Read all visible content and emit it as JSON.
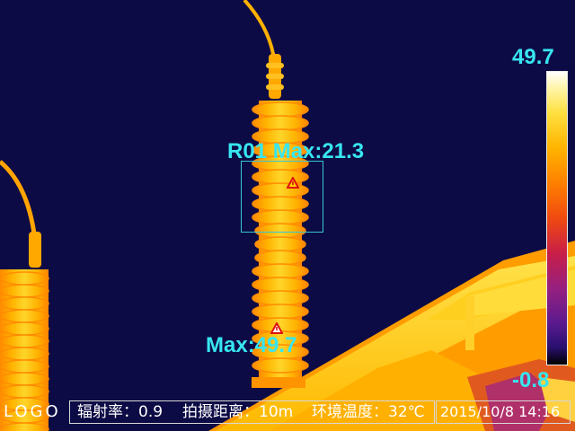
{
  "overlay": {
    "roi_label": "R01 Max:21.3",
    "max_label": "Max:49.7"
  },
  "scale": {
    "max": "49.7",
    "min": "-0.8"
  },
  "footer": {
    "logo": "LOGO",
    "emissivity": "辐射率：0.9",
    "distance": "拍摄距离：10m",
    "ambient_temperature": "环境温度：32℃",
    "datetime": "2015/10/8 14:16"
  },
  "colors": {
    "background": "#0d0b45",
    "overlay_text": "#37e6f0",
    "hot_white": "#ffffff",
    "hot_yellow": "#ffd21e",
    "warm_orange": "#ff9a00",
    "marker_red": "#e01010"
  },
  "icons": {
    "hotspot_marker": "warning-triangle-icon"
  }
}
